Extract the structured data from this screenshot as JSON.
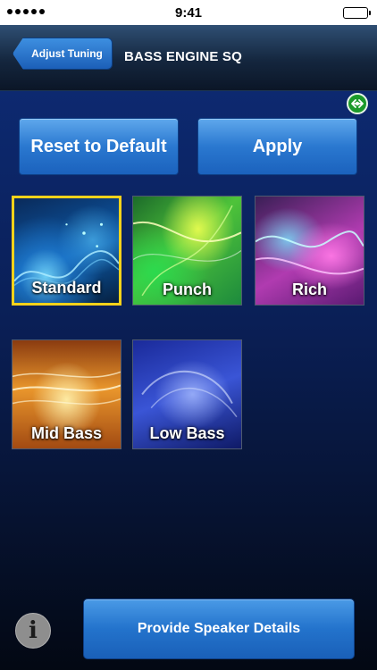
{
  "status_bar": {
    "time": "9:41",
    "signal_icon": "signal-dots-icon",
    "battery_icon": "battery-icon"
  },
  "nav": {
    "back_label": "Adjust Tuning",
    "title": "BASS ENGINE SQ"
  },
  "actions": {
    "reset_label": "Reset to Default",
    "apply_label": "Apply"
  },
  "presets": [
    {
      "label": "Standard",
      "selected": true
    },
    {
      "label": "Punch",
      "selected": false
    },
    {
      "label": "Rich",
      "selected": false
    },
    {
      "label": "Mid Bass",
      "selected": false
    },
    {
      "label": "Low Bass",
      "selected": false
    }
  ],
  "footer": {
    "info_icon": "info-icon",
    "info_label": "i",
    "speaker_label": "Provide Speaker Details"
  },
  "colors": {
    "accent": "#2a78d0",
    "selected_border": "#ffd21a",
    "background": "#0a1f56",
    "connection_status": "#1b9a2a"
  }
}
